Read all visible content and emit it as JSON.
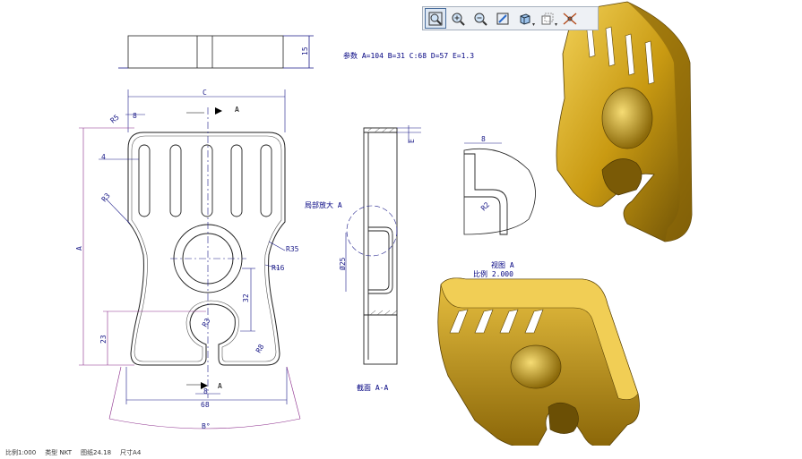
{
  "toolbar": {
    "buttons": [
      {
        "name": "zoom-fit-icon"
      },
      {
        "name": "zoom-in-icon"
      },
      {
        "name": "zoom-out-icon"
      },
      {
        "name": "repaint-icon"
      },
      {
        "name": "view-cube-icon"
      },
      {
        "name": "display-style-icon"
      },
      {
        "name": "datum-display-icon"
      }
    ]
  },
  "drawing": {
    "params_label": "参数 A=104  B=31  C:68  D=57  E=1.3",
    "top_dim": "15",
    "dim_C": "C",
    "dim_A": "A",
    "dim_B": "B°",
    "dim_8_top": "8",
    "dim_R5": "R5",
    "dim_4": "4",
    "dim_R3": "R3",
    "dim_R35": "R35",
    "dim_R16": "R16",
    "dim_32": "32",
    "dim_23": "23",
    "dim_R8": "R8",
    "dim_R3b": "R3",
    "dim_68": "68",
    "dim_8_bottom": "8",
    "section_arrow_top": "A",
    "section_arrow_bottom": "A",
    "section_label": "截面  A-A",
    "detail_label": "局部放大  A",
    "dim_E": "E",
    "dim_d25": "Ø25",
    "detail_8": "8",
    "detail_R2": "R2",
    "view_label": "视图  A",
    "view_scale": "比例 2.000"
  },
  "status": {
    "scale": "比例1:000",
    "type": "类型 NKT",
    "sheet": "图纸24.18",
    "size": "尺寸A4"
  },
  "colors": {
    "part": "#c99a12",
    "part_dark": "#6b4f05",
    "part_light": "#f2cf55",
    "outline": "#3a3a3a",
    "dimension": "#1a1a88",
    "construction": "#8a2a8a"
  }
}
